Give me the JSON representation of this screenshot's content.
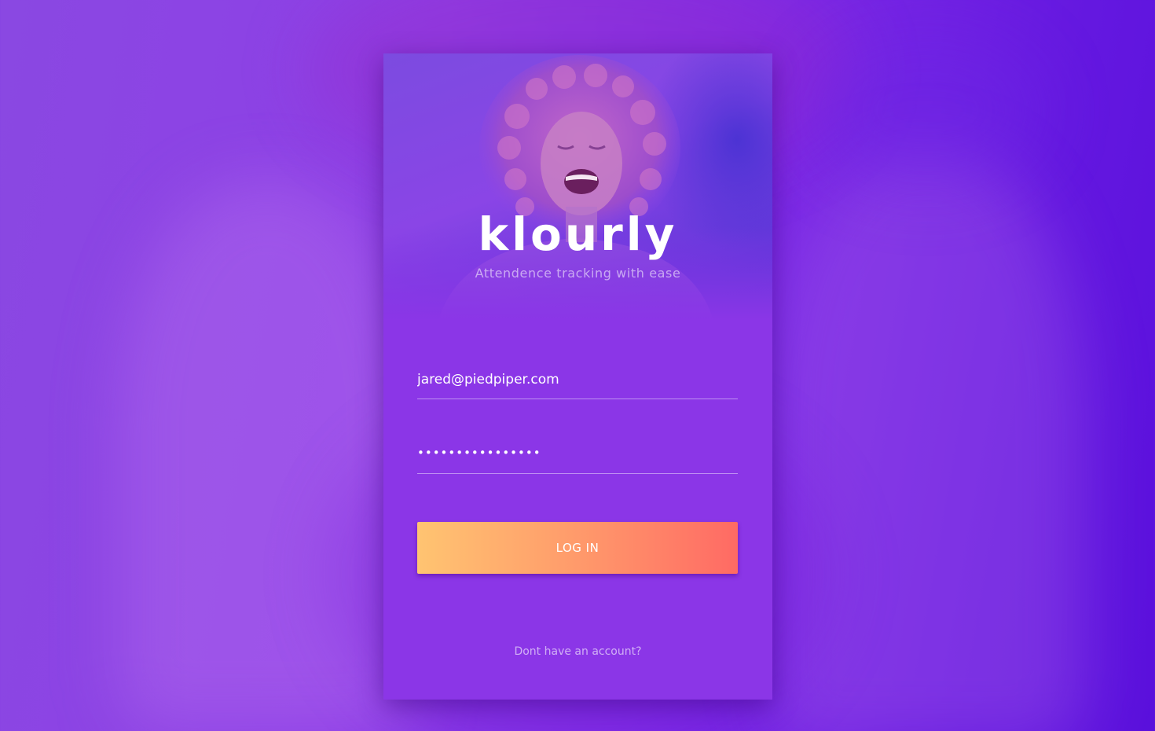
{
  "app": {
    "brand_name": "klourly",
    "tagline": "Attendence tracking with ease"
  },
  "login_form": {
    "email_value": "jared@piedpiper.com",
    "password_mask": "••••••••••••••••",
    "login_button_label": "LOG IN",
    "signup_prompt": "Dont have an account?"
  },
  "colors": {
    "card_background": "#8b36e7",
    "button_gradient_start": "#ffc471",
    "button_gradient_end": "#ff6a64",
    "text": "#ffffff"
  },
  "hero_image": {
    "subject": "laughing woman with curly hair",
    "tint": "purple"
  }
}
